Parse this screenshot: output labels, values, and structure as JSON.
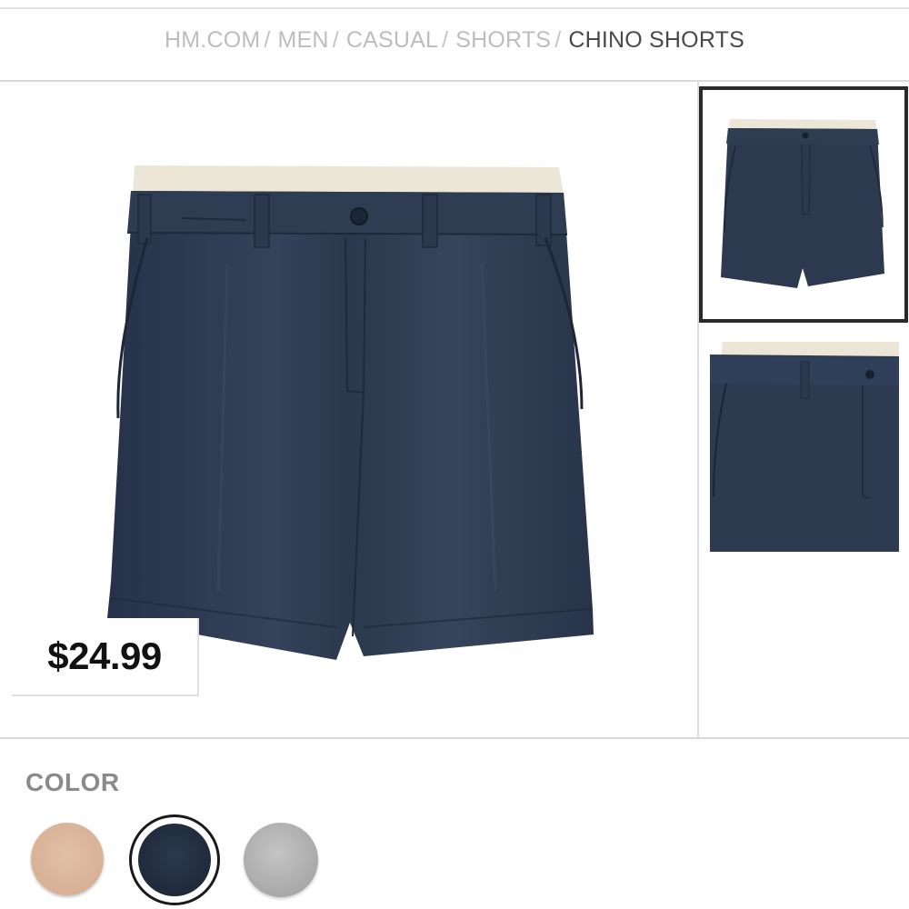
{
  "breadcrumb": {
    "items": [
      "HM.COM",
      "MEN",
      "CASUAL",
      "SHORTS"
    ],
    "separator": "/",
    "current": "CHINO SHORTS"
  },
  "product": {
    "price": "$24.99",
    "image_icon": "navy-chino-shorts-image"
  },
  "thumbnails": [
    {
      "icon": "shorts-front-thumbnail",
      "selected": true
    },
    {
      "icon": "shorts-closeup-thumbnail",
      "selected": false
    }
  ],
  "color": {
    "label": "COLOR",
    "swatches": [
      {
        "name": "beige",
        "hex": "#D9B398",
        "selected": false
      },
      {
        "name": "navy",
        "hex": "#1F2A3A",
        "selected": true
      },
      {
        "name": "grey",
        "hex": "#ABABAB",
        "selected": false
      }
    ]
  },
  "colors": {
    "text_muted": "#BDBDBD",
    "text_current": "#4A4A4A",
    "shorts_navy": "#2E3B4E"
  }
}
